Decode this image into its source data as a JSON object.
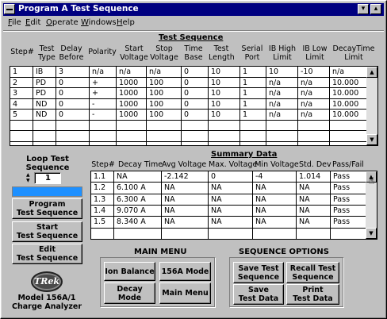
{
  "window": {
    "title": "Program A Test Sequence",
    "minimize_glyph": "▾",
    "maximize_glyph": "▴"
  },
  "menu": [
    {
      "first": "F",
      "rest": "ile"
    },
    {
      "first": "E",
      "rest": "dit"
    },
    {
      "first": "O",
      "rest": "perate"
    },
    {
      "first": "W",
      "rest": "indows"
    },
    {
      "first": "H",
      "rest": "elp"
    }
  ],
  "test_sequence": {
    "title": "Test Sequence",
    "headers": [
      "Step#",
      "Test\nType",
      "Delay\nBefore",
      "Polarity",
      "Start\nVoltage",
      "Stop\nVoltage",
      "Time\nBase",
      "Test\nLength",
      "Serial\nPort",
      "IB High\nLimit",
      "IB Low\nLimit",
      "DecayTime\nLimit"
    ],
    "rows": [
      [
        "1",
        "IB",
        "3",
        "n/a",
        "n/a",
        "n/a",
        "0",
        "10",
        "1",
        "10",
        "-10",
        "n/a"
      ],
      [
        "2",
        "PD",
        "0",
        "+",
        "1000",
        "100",
        "0",
        "10",
        "1",
        "n/a",
        "n/a",
        "10.000"
      ],
      [
        "3",
        "PD",
        "0",
        "+",
        "1000",
        "100",
        "0",
        "10",
        "1",
        "n/a",
        "n/a",
        "10.000"
      ],
      [
        "4",
        "ND",
        "0",
        "-",
        "1000",
        "100",
        "0",
        "10",
        "1",
        "n/a",
        "n/a",
        "10.000"
      ],
      [
        "5",
        "ND",
        "0",
        "-",
        "1000",
        "100",
        "0",
        "10",
        "1",
        "n/a",
        "n/a",
        "10.000"
      ],
      [
        "",
        "",
        "",
        "",
        "",
        "",
        "",
        "",
        "",
        "",
        "",
        ""
      ],
      [
        "",
        "",
        "",
        "",
        "",
        "",
        "",
        "",
        "",
        "",
        "",
        ""
      ]
    ]
  },
  "loop": {
    "label": "Loop Test\nSequence",
    "value": "1"
  },
  "left_buttons": {
    "program": "Program\nTest Sequence",
    "start": "Start\nTest Sequence",
    "edit": "Edit\nTest Sequence"
  },
  "logo": {
    "brand": "TRek",
    "model": "Model 156A/1\nCharge Analyzer"
  },
  "summary": {
    "title": "Summary Data",
    "headers": [
      "Step#",
      "Decay Time",
      "Avg Voltage",
      "Max. Voltage",
      "Min Voltage",
      "Std. Dev",
      "Pass/Fail"
    ],
    "rows": [
      [
        "1.1",
        "NA",
        "-2.142",
        "0",
        "-4",
        "1.014",
        "Pass"
      ],
      [
        "1.2",
        "6.100 A",
        "NA",
        "NA",
        "NA",
        "NA",
        "Pass"
      ],
      [
        "1.3",
        "6.300 A",
        "NA",
        "NA",
        "NA",
        "NA",
        "Pass"
      ],
      [
        "1.4",
        "9.070 A",
        "NA",
        "NA",
        "NA",
        "NA",
        "Pass"
      ],
      [
        "1.5",
        "8.340 A",
        "NA",
        "NA",
        "NA",
        "NA",
        "Pass"
      ],
      [
        "",
        "",
        "",
        "",
        "",
        "",
        ""
      ]
    ]
  },
  "main_menu": {
    "title": "MAIN MENU",
    "ion": "Ion Balance",
    "mode156": "156A Mode",
    "decay": "Decay\nMode",
    "main": "Main Menu"
  },
  "seq_options": {
    "title": "SEQUENCE OPTIONS",
    "save_seq": "Save Test\nSequence",
    "recall_seq": "Recall Test\nSequence",
    "save_data": "Save\nTest Data",
    "print_data": "Print\nTest Data"
  },
  "colors": {
    "titlebar": "#000080",
    "progress": "#1e90ff",
    "face": "#c0c0c0"
  }
}
